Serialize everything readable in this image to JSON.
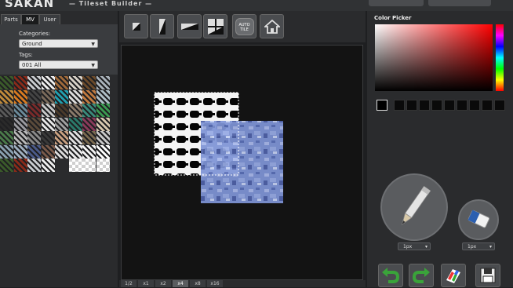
{
  "header": {
    "logo": "SAKAN",
    "subtitle": "— Tileset Builder —"
  },
  "left_panel": {
    "tabs": [
      {
        "label": "Parts",
        "active": false
      },
      {
        "label": "MV",
        "active": true
      },
      {
        "label": "User",
        "active": false
      }
    ],
    "categories_label": "Categories:",
    "categories_value": "Ground",
    "tags_label": "Tags:",
    "tags_value": "001 All"
  },
  "toolbar": {
    "tools": [
      "square-tile-icon",
      "tall-tile-icon",
      "wide-tile-icon",
      "grid-tile-icon",
      "auto-tile-icon",
      "home-icon"
    ],
    "auto_tile_label": "AUTO TILE"
  },
  "zoom": {
    "levels": [
      "1/2",
      "x1",
      "x2",
      "x4",
      "x8",
      "x16"
    ],
    "active": "x4"
  },
  "right_panel": {
    "color_picker_title": "Color Picker",
    "pencil_size": "1px",
    "eraser_size": "1px",
    "swatch_count": 9
  }
}
